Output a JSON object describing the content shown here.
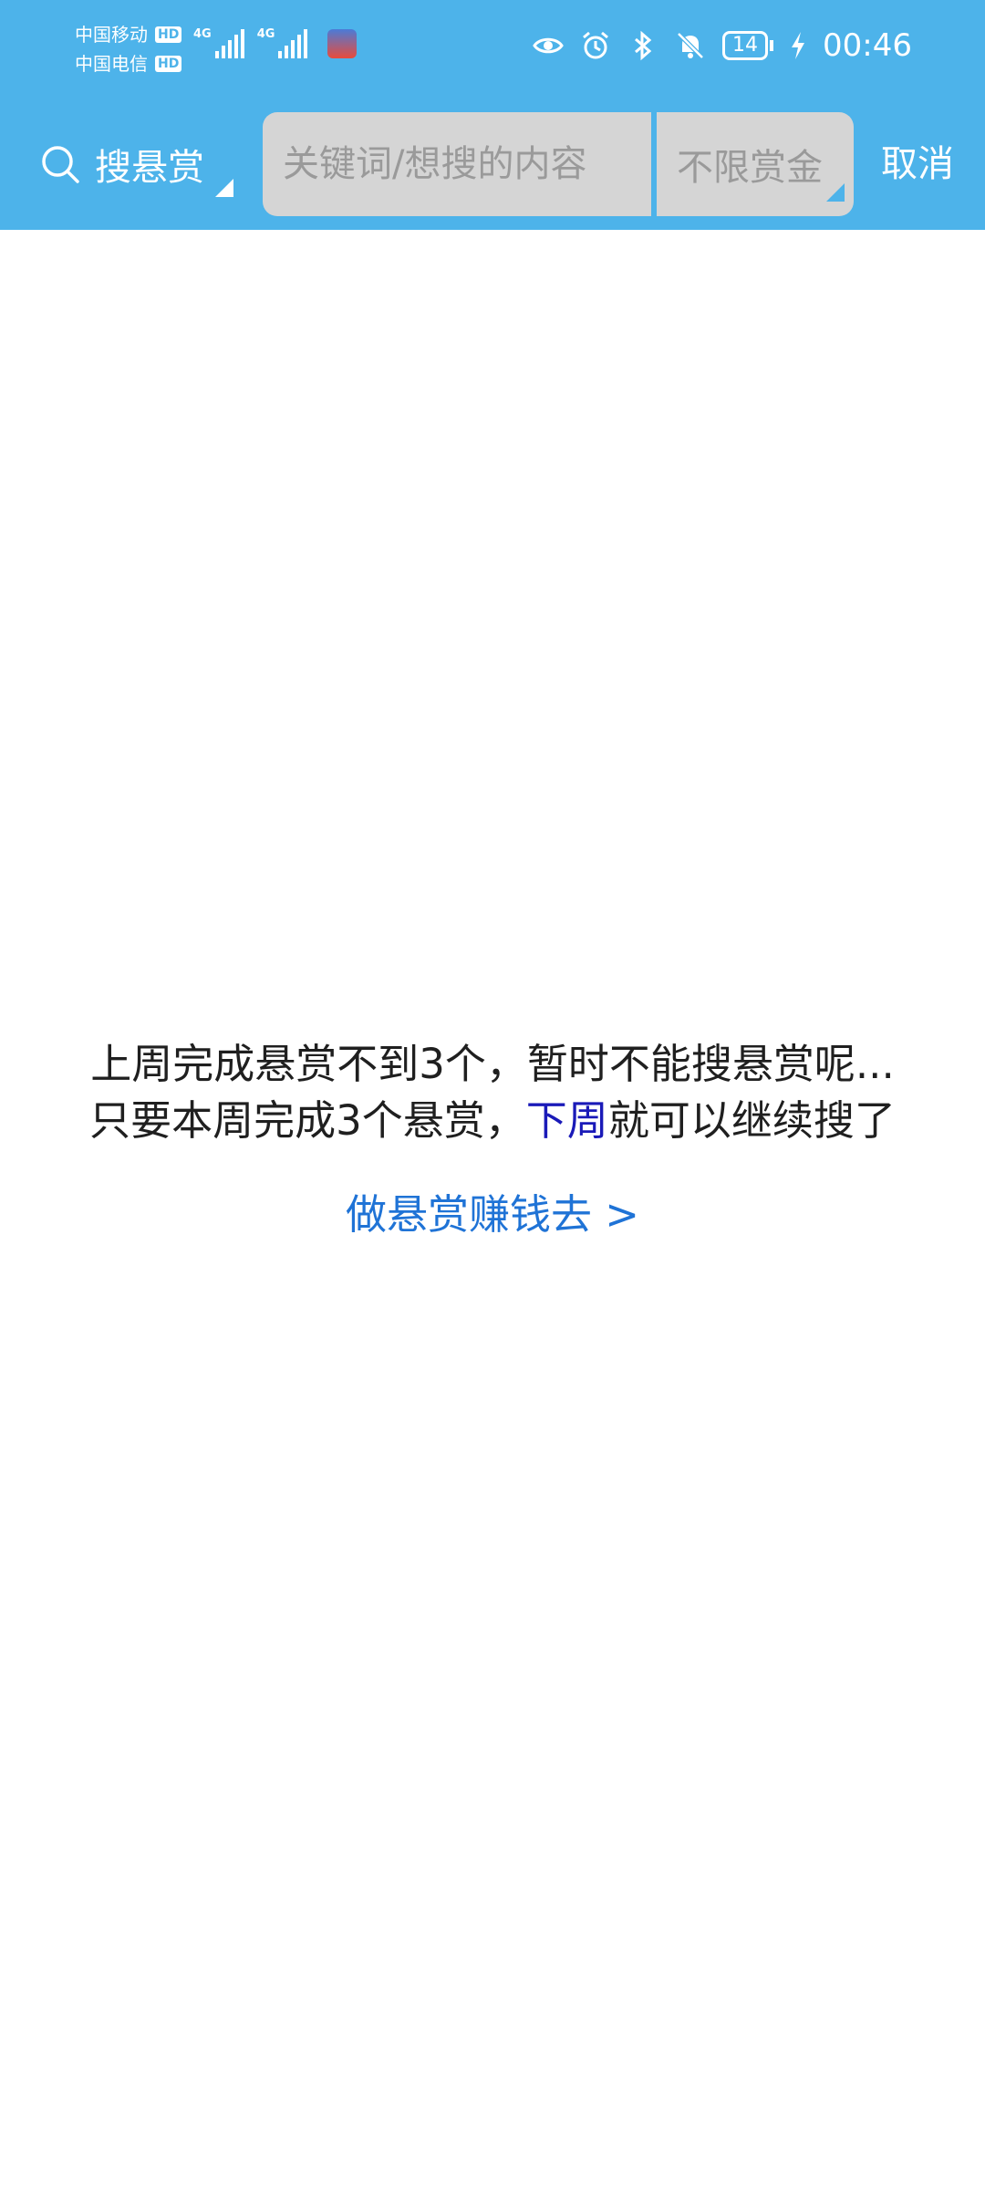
{
  "status_bar": {
    "carrier_1": "中国移动",
    "carrier_2": "中国电信",
    "hd_badge": "HD",
    "network_1": "4G",
    "network_2": "4G",
    "battery_level": "14",
    "time": "00:46"
  },
  "header": {
    "search_type_label": "搜悬赏",
    "search_placeholder": "关键词/想搜的内容",
    "reward_filter_label": "不限赏金",
    "cancel_label": "取消",
    "bg_color": "#4db3ea"
  },
  "message": {
    "line1": "上周完成悬赏不到3个，暂时不能搜悬赏呢...",
    "line2_prefix": "只要本周完成3个悬赏，",
    "line2_highlight": "下周",
    "line2_suffix": "就可以继续搜了",
    "highlight_color": "#1a1ab8"
  },
  "earn_link": {
    "label": "做悬赏赚钱去 >",
    "color": "#1f73d6"
  }
}
